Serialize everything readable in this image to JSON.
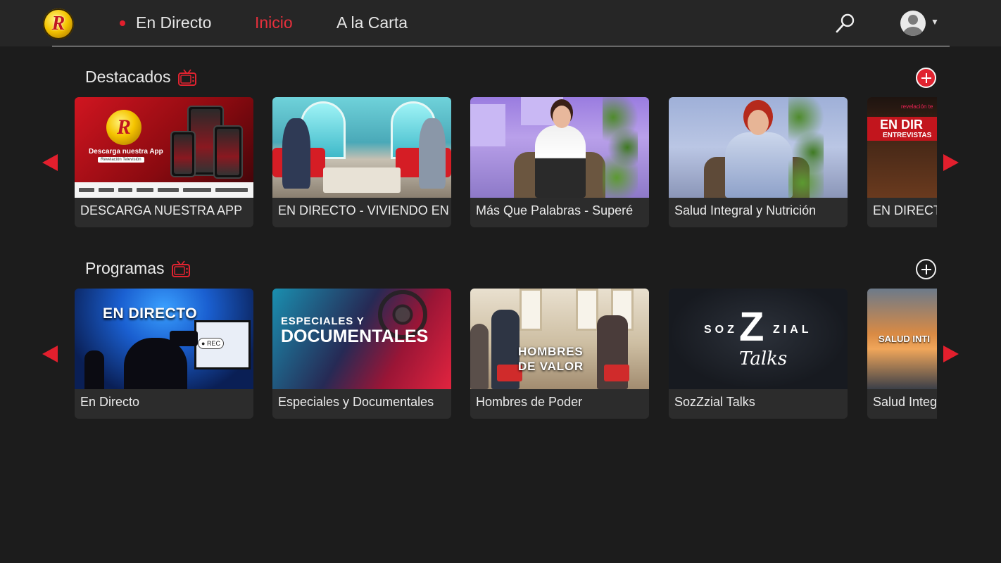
{
  "nav": {
    "live_label": "En Directo",
    "home_label": "Inicio",
    "vod_label": "A la Carta",
    "logo_text": "R"
  },
  "colors": {
    "accent": "#e21f2d",
    "background": "#1c1c1c",
    "topbar": "#262626",
    "card": "#2c2c2c"
  },
  "rows": [
    {
      "title": "Destacados",
      "cards": [
        {
          "label": "DESCARGA NUESTRA APP",
          "thumb": {
            "line1": "Descarga nuestra App",
            "line2": "Revelación Televisión"
          }
        },
        {
          "label": "EN DIRECTO - VIVIENDO EN"
        },
        {
          "label": "Más Que Palabras - Superé"
        },
        {
          "label": "Salud Integral y Nutrición"
        },
        {
          "label": "EN DIRECTO",
          "thumb": {
            "small": "revelación te",
            "line1": "EN DIR",
            "line2": "ENTREVISTAS"
          }
        }
      ]
    },
    {
      "title": "Programas",
      "cards": [
        {
          "label": "En Directo",
          "thumb": {
            "title": "EN DIRECTO",
            "rec": "REC"
          }
        },
        {
          "label": "Especiales y Documentales",
          "thumb": {
            "line1": "ESPECIALES Y",
            "line2": "DOCUMENTALES"
          }
        },
        {
          "label": "Hombres de Poder",
          "thumb": {
            "line1": "HOMBRES",
            "line2": "DE VALOR"
          }
        },
        {
          "label": "SozZzial Talks",
          "thumb": {
            "left": "SOZ",
            "big": "Z",
            "right": "ZIAL",
            "script": "Talks"
          }
        },
        {
          "label": "Salud Integ",
          "thumb": {
            "title": "SALUD INTI"
          }
        }
      ]
    }
  ]
}
